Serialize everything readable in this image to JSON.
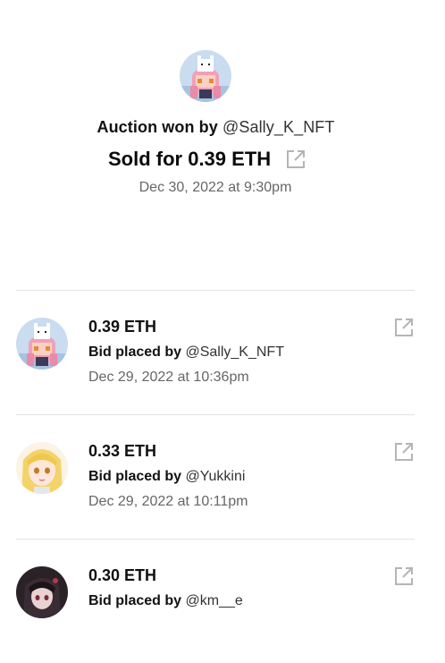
{
  "summary": {
    "won_prefix": "Auction won by",
    "winner_handle": "@Sally_K_NFT",
    "sold_text": "Sold for 0.39 ETH",
    "date": "Dec 30, 2022 at 9:30pm",
    "avatar_icon": "pink-hair-character-avatar",
    "link_icon": "external-link-icon"
  },
  "bids": [
    {
      "amount": "0.39 ETH",
      "by_prefix": "Bid placed by",
      "handle": "@Sally_K_NFT",
      "date": "Dec 29, 2022 at 10:36pm",
      "avatar_icon": "pink-hair-character-avatar"
    },
    {
      "amount": "0.33 ETH",
      "by_prefix": "Bid placed by",
      "handle": "@Yukkini",
      "date": "Dec 29, 2022 at 10:11pm",
      "avatar_icon": "blonde-anime-girl-avatar"
    },
    {
      "amount": "0.30 ETH",
      "by_prefix": "Bid placed by",
      "handle": "@km__e",
      "date": "",
      "avatar_icon": "dark-hair-character-avatar"
    }
  ],
  "colors": {
    "text_primary": "#111111",
    "text_secondary": "#666666",
    "divider": "#e2e2e2",
    "icon": "#b5b5b5"
  }
}
